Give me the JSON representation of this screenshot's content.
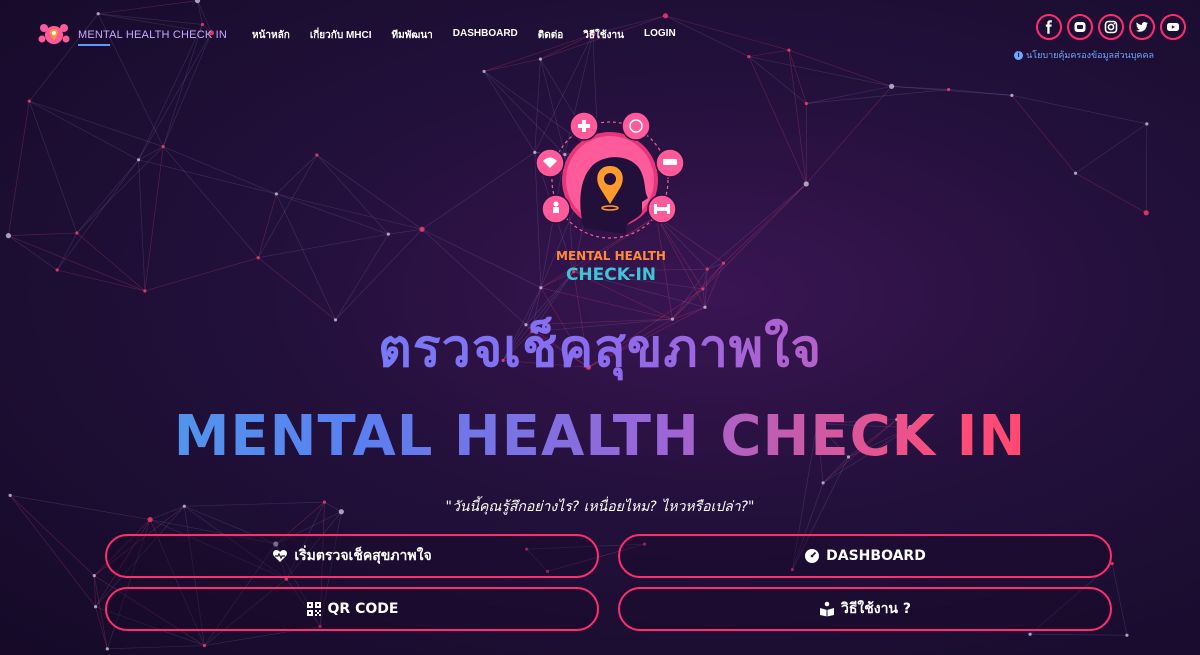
{
  "brand": {
    "name": "MENTAL HEALTH CHECK IN"
  },
  "nav": {
    "items": [
      {
        "label": "หน้าหลัก"
      },
      {
        "label": "เกี่ยวกับ MHCI"
      },
      {
        "label": "ทีมพัฒนา"
      },
      {
        "label": "DASHBOARD"
      },
      {
        "label": "ติดต่อ"
      },
      {
        "label": "วิธีใช้งาน"
      },
      {
        "label": "LOGIN"
      }
    ]
  },
  "social": {
    "icons": [
      "facebook-icon",
      "line-icon",
      "instagram-icon",
      "twitter-icon",
      "youtube-icon"
    ],
    "accent": "#ff2d6f"
  },
  "privacy": {
    "label": "นโยบายคุ้มครองข้อมูลส่วนบุคคล"
  },
  "hero": {
    "logo_line1": "MENTAL HEALTH",
    "logo_line2": "CHECK-IN",
    "title_th": "ตรวจเช็คสุขภาพใจ",
    "title_en": "MENTAL HEALTH CHECK IN",
    "subtitle": "\"วันนี้คุณรู้สึกอย่างไร? เหนื่อยไหม? ไหวหรือเปล่า?\""
  },
  "buttons": {
    "start": "เริ่มตรวจเช็คสุขภาพใจ",
    "dashboard": "DASHBOARD",
    "qr": "QR CODE",
    "howto": "วิธีใช้งาน ?"
  },
  "colors": {
    "accent": "#ff2d6f",
    "background": "#1a0c30",
    "blue": "#5a8dff"
  }
}
